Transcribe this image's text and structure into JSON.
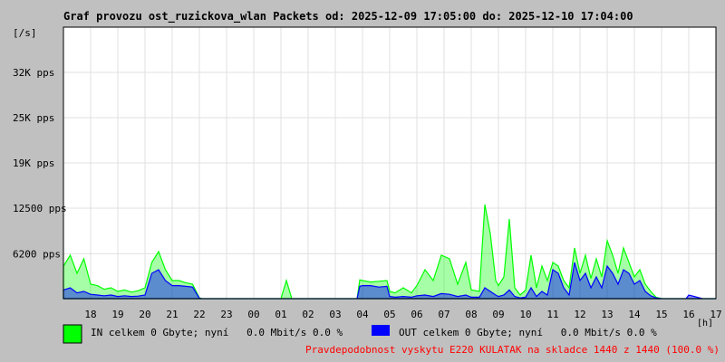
{
  "chart_data": {
    "type": "area",
    "title": "Graf provozu ost_ruzickova_wlan Packets od: 2025-12-09 17:05:00 do: 2025-12-10 17:04:00",
    "ylabel": "[/s]",
    "xlabel": "[h]",
    "ylim": [
      0,
      37500
    ],
    "y_ticks": [
      {
        "value": 6200,
        "label": "6200 pps"
      },
      {
        "value": 12500,
        "label": "12500 pps"
      },
      {
        "value": 18750,
        "label": "19K pps"
      },
      {
        "value": 25000,
        "label": "25K pps"
      },
      {
        "value": 31250,
        "label": "32K pps"
      }
    ],
    "x_ticks": [
      "18",
      "19",
      "20",
      "21",
      "22",
      "23",
      "00",
      "01",
      "02",
      "03",
      "04",
      "05",
      "06",
      "07",
      "08",
      "09",
      "10",
      "11",
      "12",
      "13",
      "14",
      "15",
      "16",
      "17"
    ],
    "grid": true,
    "series": [
      {
        "name": "IN",
        "color": "#00ff00",
        "x": [
          17.0,
          17.25,
          17.5,
          17.75,
          18.0,
          18.25,
          18.5,
          18.75,
          19.0,
          19.25,
          19.5,
          19.75,
          20.0,
          20.25,
          20.5,
          20.75,
          21.0,
          21.25,
          21.5,
          21.75,
          22.0,
          22.1,
          23.0,
          24.0,
          25.0,
          25.2,
          25.4,
          26.0,
          27.0,
          27.8,
          27.9,
          28.0,
          28.3,
          28.6,
          28.9,
          29.0,
          29.2,
          29.5,
          29.8,
          30.0,
          30.3,
          30.6,
          30.9,
          31.2,
          31.5,
          31.8,
          32.0,
          32.3,
          32.5,
          32.7,
          32.9,
          33.0,
          33.2,
          33.4,
          33.6,
          33.8,
          34.0,
          34.2,
          34.4,
          34.6,
          34.8,
          35.0,
          35.2,
          35.4,
          35.6,
          35.8,
          36.0,
          36.2,
          36.4,
          36.6,
          36.8,
          37.0,
          37.2,
          37.4,
          37.6,
          37.8,
          38.0,
          38.2,
          38.4,
          38.6,
          38.8,
          39.0,
          39.2,
          39.4,
          39.6,
          39.8,
          40.0,
          40.5,
          41.0
        ],
        "values": [
          4500,
          6000,
          3500,
          5500,
          2000,
          1800,
          1300,
          1500,
          1000,
          1200,
          900,
          1100,
          1500,
          5000,
          6500,
          4000,
          2500,
          2500,
          2200,
          2000,
          100,
          0,
          0,
          0,
          0,
          2500,
          0,
          0,
          0,
          0,
          2600,
          2500,
          2300,
          2400,
          2500,
          1000,
          800,
          1500,
          800,
          1800,
          4000,
          2500,
          6000,
          5500,
          2000,
          5000,
          1200,
          1000,
          13000,
          9000,
          2500,
          1800,
          3000,
          11000,
          1500,
          500,
          1200,
          6000,
          1500,
          4500,
          2500,
          5000,
          4500,
          2500,
          1500,
          7000,
          3500,
          6000,
          2800,
          5500,
          3000,
          8000,
          6000,
          3500,
          7000,
          5000,
          3000,
          4000,
          2000,
          1000,
          200,
          0,
          0,
          0,
          0,
          0,
          0,
          0,
          0
        ]
      },
      {
        "name": "OUT",
        "color": "#0000ff",
        "x": [
          17.0,
          17.25,
          17.5,
          17.75,
          18.0,
          18.25,
          18.5,
          18.75,
          19.0,
          19.25,
          19.5,
          19.75,
          20.0,
          20.25,
          20.5,
          20.75,
          21.0,
          21.25,
          21.5,
          21.75,
          22.0,
          22.1,
          23.0,
          24.0,
          25.0,
          26.0,
          27.0,
          27.8,
          27.9,
          28.0,
          28.3,
          28.6,
          28.9,
          29.0,
          29.2,
          29.5,
          29.8,
          30.0,
          30.3,
          30.6,
          30.9,
          31.2,
          31.5,
          31.8,
          32.0,
          32.3,
          32.5,
          32.7,
          32.9,
          33.0,
          33.2,
          33.4,
          33.6,
          33.8,
          34.0,
          34.2,
          34.4,
          34.6,
          34.8,
          35.0,
          35.2,
          35.4,
          35.6,
          35.8,
          36.0,
          36.2,
          36.4,
          36.6,
          36.8,
          37.0,
          37.2,
          37.4,
          37.6,
          37.8,
          38.0,
          38.2,
          38.4,
          38.6,
          38.8,
          39.0,
          39.5,
          39.9,
          40.0,
          40.5,
          41.0
        ],
        "values": [
          1200,
          1500,
          800,
          1000,
          600,
          500,
          400,
          500,
          300,
          400,
          300,
          350,
          500,
          3500,
          4000,
          2500,
          1800,
          1800,
          1700,
          1600,
          50,
          0,
          0,
          0,
          0,
          0,
          0,
          0,
          1700,
          1800,
          1800,
          1600,
          1700,
          300,
          200,
          300,
          200,
          400,
          500,
          300,
          700,
          600,
          300,
          500,
          200,
          200,
          1500,
          1000,
          500,
          300,
          500,
          1200,
          300,
          100,
          200,
          1500,
          300,
          1000,
          500,
          4000,
          3500,
          1500,
          500,
          5000,
          2500,
          3500,
          1500,
          3000,
          1500,
          4500,
          3500,
          2000,
          4000,
          3500,
          2000,
          2500,
          1000,
          400,
          100,
          0,
          0,
          0,
          500,
          0,
          0
        ]
      }
    ]
  },
  "legend": {
    "in_text": "IN celkem 0 Gbyte; nyní   0.0 Mbit/s 0.0 %",
    "out_text": "OUT celkem 0 Gbyte; nyní   0.0 Mbit/s 0.0 %",
    "in_color": "#00ff00",
    "out_color": "#0000ff"
  },
  "footer": {
    "text": "Pravdepodobnost vyskytu E220 KULATAK na skladce 1440 z 1440 (100.0 %)",
    "color": "#ff0000"
  }
}
